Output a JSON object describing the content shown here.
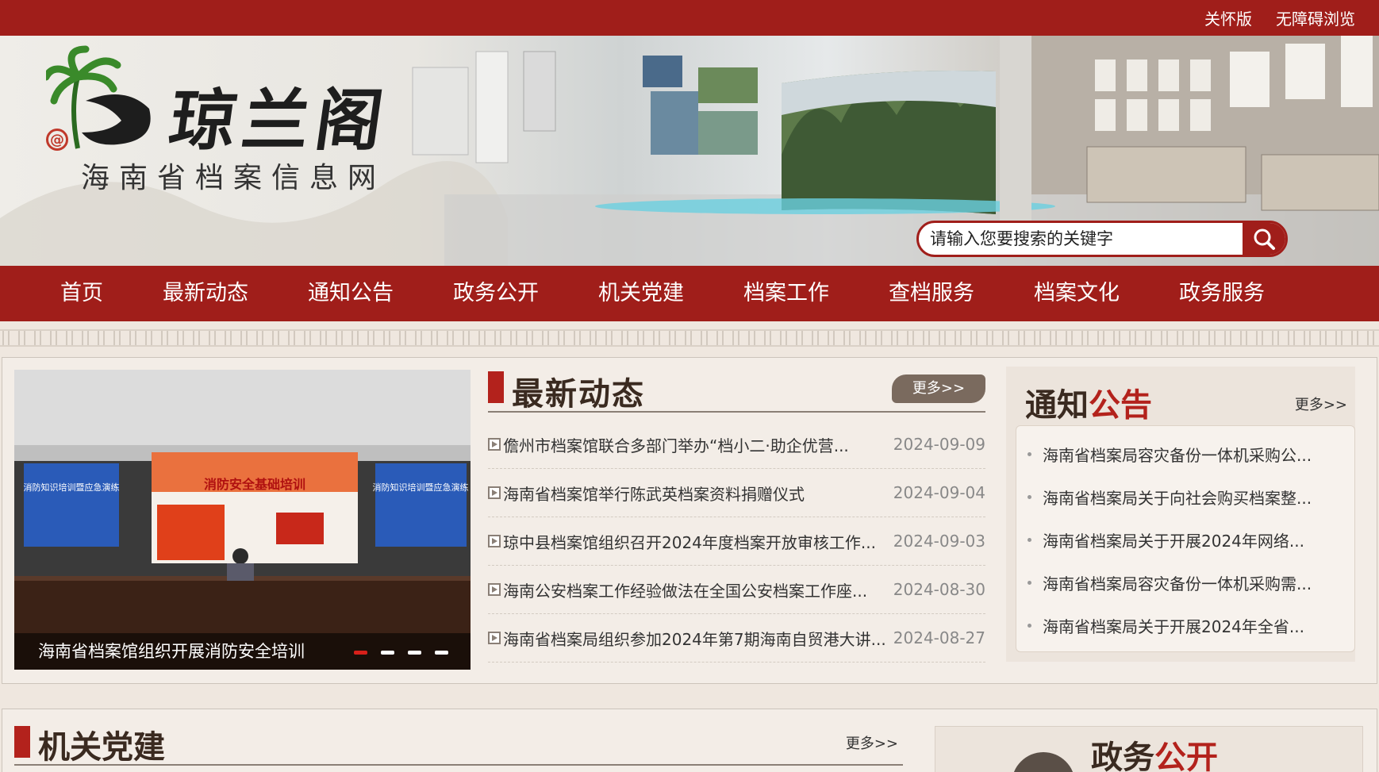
{
  "topbar": {
    "care_label": "关怀版",
    "accessible_label": "无障碍浏览"
  },
  "brand": {
    "logo_title": "琼兰阁",
    "site_name": "海南省档案信息网"
  },
  "search": {
    "placeholder": "请输入您要搜索的关键字"
  },
  "nav": {
    "items": [
      "首页",
      "最新动态",
      "通知公告",
      "政务公开",
      "机关党建",
      "档案工作",
      "查档服务",
      "档案文化",
      "政务服务"
    ]
  },
  "slider": {
    "caption": "海南省档案馆组织开展消防安全培训",
    "active_index": 0,
    "slide_count": 4,
    "screen_left_text": "消防知识培训暨应急演练",
    "screen_center_text": "消防安全基础培训"
  },
  "news": {
    "title": "最新动态",
    "more": "更多>>",
    "items": [
      {
        "title": "儋州市档案馆联合多部门举办“档小二·助企优营...",
        "date": "2024-09-09"
      },
      {
        "title": "海南省档案馆举行陈武英档案资料捐赠仪式",
        "date": "2024-09-04"
      },
      {
        "title": "琼中县档案馆组织召开2024年度档案开放审核工作...",
        "date": "2024-09-03"
      },
      {
        "title": "海南公安档案工作经验做法在全国公安档案工作座...",
        "date": "2024-08-30"
      },
      {
        "title": "海南省档案局组织参加2024年第7期海南自贸港大讲...",
        "date": "2024-08-27"
      }
    ]
  },
  "notice": {
    "title_a": "通知",
    "title_b": "公告",
    "more": "更多>>",
    "items": [
      "海南省档案局容灾备份一体机采购公...",
      "海南省档案局关于向社会购买档案整...",
      "海南省档案局关于开展2024年网络...",
      "海南省档案局容灾备份一体机采购需...",
      "海南省档案局关于开展2024年全省..."
    ]
  },
  "party": {
    "title": "机关党建",
    "more": "更多>>"
  },
  "gov_open": {
    "title_a": "政务",
    "title_b": "公开"
  },
  "colors": {
    "brand_red": "#a01e1a",
    "accent_red": "#b3221c",
    "page_bg": "#efe7df"
  }
}
